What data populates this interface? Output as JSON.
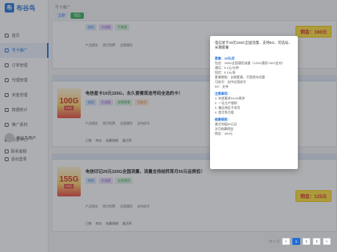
{
  "app": {
    "logo_mark": "布",
    "logo_text": "布谷鸟"
  },
  "sidebar": {
    "items": [
      {
        "label": "首页"
      },
      {
        "label": "号卡推广"
      },
      {
        "label": "订单管理"
      },
      {
        "label": "代理管理"
      },
      {
        "label": "资金管理"
      },
      {
        "label": "数据统计"
      },
      {
        "label": "推广素材"
      },
      {
        "label": "设置中心"
      }
    ],
    "user_name": "布谷鸟用户",
    "link_service": "联系客服",
    "link_logout": "退出登录"
  },
  "main": {
    "crumb": "号卡推广",
    "filters": [
      "全部",
      "电信"
    ]
  },
  "cards": [
    {
      "head": "",
      "thumb_big": "",
      "thumb_small": "",
      "title": "",
      "tags": [
        "电信",
        "大流量",
        "不限速"
      ],
      "meta": [
        "产品佣金",
        "首月免费",
        "全国通用"
      ],
      "price": "佣金：160元"
    },
    {
      "head": "",
      "thumb_big": "100G",
      "thumb_small": "19元",
      "title": "电信星卡19元155G，永久套餐首选号码全选的卡！",
      "tags": [
        "电信",
        "大流量",
        "长期套餐",
        "可选号"
      ],
      "meta": [
        "产品佣金",
        "首月免费",
        "全国通用",
        "支持选号"
      ],
      "info": [
        "已售",
        "库存",
        "结算周期",
        "激活率"
      ],
      "price": ""
    },
    {
      "head": "",
      "thumb_big": "155G",
      "thumb_small": "29元",
      "title": "电信印记29元155G全国流量，流量支持结转首月50元话费抵！",
      "tags": [
        "电信",
        "大流量",
        "全国通用"
      ],
      "meta": [
        "产品佣金",
        "首月免费",
        "全国通用",
        "支持选号"
      ],
      "info": [
        "已售",
        "库存",
        "结算周期",
        "激活率"
      ],
      "price": "佣金：125元"
    }
  ],
  "popup": {
    "title": "电信星卡19元155G全国流量、支持5G、可选号、长期套餐",
    "sec1": "套餐：19元/月",
    "lines1": [
      "包含：155G全国通用流量（125G通用+30G定向）",
      "通话：0.1元/分钟",
      "短信：0.1元/条",
      "套餐期限：长期套餐，不是首年优惠",
      "可选号：支持全国选号",
      "5G：支持"
    ],
    "sec2": "注意事项：",
    "lines2": [
      "1. 年龄要求16-60周岁",
      "2. 一证五户限制",
      "3. 偏远地区不发货",
      "4. 首月免月租"
    ],
    "sec3": "结算规则：",
    "lines3": [
      "激活充值50元后",
      "次月结算佣金"
    ],
    "sec4": "",
    "red": "佣金：160元"
  },
  "pager": {
    "prev": "<",
    "pages": [
      "1",
      "2",
      "3"
    ],
    "active": "1",
    "next": ">",
    "total": "共 3 页"
  }
}
